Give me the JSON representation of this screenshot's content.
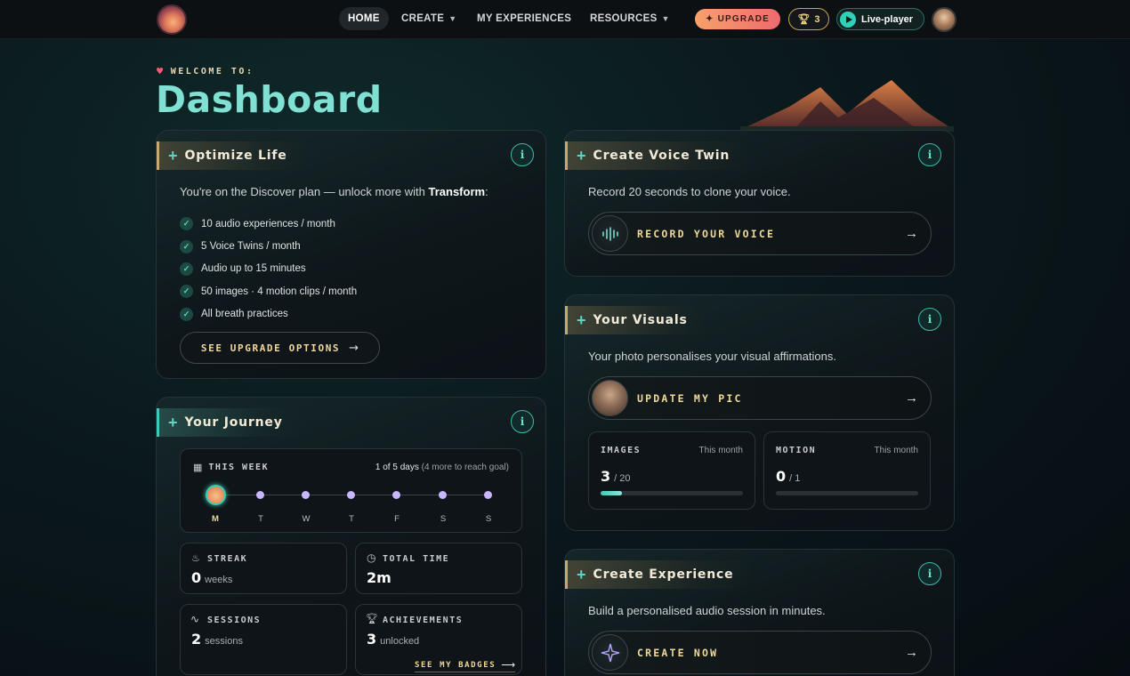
{
  "nav": {
    "home": "HOME",
    "create": "CREATE",
    "experiences": "MY EXPERIENCES",
    "resources": "RESOURCES",
    "upgrade": "UPGRADE",
    "trophy_count": "3",
    "live_player": "Live-player"
  },
  "header": {
    "welcome": "WELCOME TO:",
    "title": "Dashboard"
  },
  "optimize": {
    "title": "Optimize Life",
    "intro_prefix": "You're on the Discover plan — unlock more with ",
    "intro_bold": "Transform",
    "intro_suffix": ":",
    "features": [
      "10 audio experiences / month",
      "5 Voice Twins / month",
      "Audio up to 15 minutes",
      "50 images · 4 motion clips / month",
      "All breath practices"
    ],
    "button": "SEE UPGRADE OPTIONS"
  },
  "journey": {
    "title": "Your Journey",
    "week_label": "THIS WEEK",
    "progress_main": "1 of 5 days",
    "progress_note": "(4 more to reach goal)",
    "days": [
      "M",
      "T",
      "W",
      "T",
      "F",
      "S",
      "S"
    ],
    "stats": {
      "streak_label": "STREAK",
      "streak_value": "0",
      "streak_unit": "weeks",
      "time_label": "TOTAL TIME",
      "time_value": "2m",
      "sessions_label": "SESSIONS",
      "sessions_value": "2",
      "sessions_unit": "sessions",
      "achievements_label": "ACHIEVEMENTS",
      "achievements_value": "3",
      "achievements_unit": "unlocked",
      "badges_link": "SEE MY BADGES"
    }
  },
  "voice": {
    "title": "Create Voice Twin",
    "text": "Record 20 seconds to clone your voice.",
    "button": "RECORD YOUR VOICE"
  },
  "visuals": {
    "title": "Your Visuals",
    "text": "Your photo personalises your visual affirmations.",
    "button": "UPDATE MY PIC",
    "images_label": "IMAGES",
    "images_period": "This month",
    "images_value": "3",
    "images_total": "/ 20",
    "images_progress": 0.15,
    "motion_label": "MOTION",
    "motion_period": "This month",
    "motion_value": "0",
    "motion_total": "/ 1",
    "motion_progress": 0
  },
  "experience": {
    "title": "Create Experience",
    "text": "Build a personalised audio session in minutes.",
    "button": "CREATE NOW"
  },
  "colors": {
    "accent_teal": "#3fc8b6",
    "accent_gold": "#efd89a",
    "upgrade_gradient_start": "#f6a26a",
    "upgrade_gradient_end": "#ee6a6e"
  }
}
